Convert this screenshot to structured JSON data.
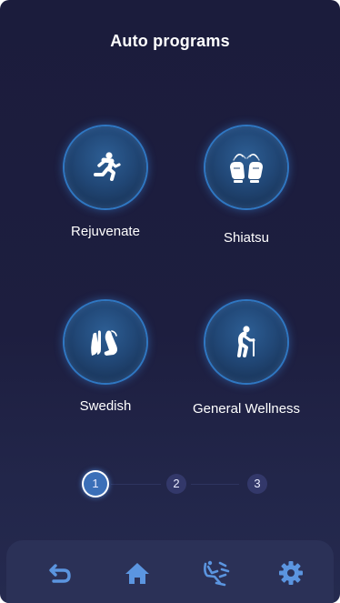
{
  "header": {
    "title": "Auto programs"
  },
  "programs": [
    {
      "label": "Rejuvenate",
      "icon": "running-person-icon"
    },
    {
      "label": "Shiatsu",
      "icon": "pressing-hands-icon"
    },
    {
      "label": "Swedish",
      "icon": "massage-hands-icon"
    },
    {
      "label": "General Wellness",
      "icon": "elderly-person-with-cane-icon"
    }
  ],
  "pagination": {
    "pages": [
      "1",
      "2",
      "3"
    ],
    "current": "1"
  },
  "bottom_nav": [
    {
      "icon": "back-icon"
    },
    {
      "icon": "home-icon"
    },
    {
      "icon": "massage-chair-icon"
    },
    {
      "icon": "settings-gear-icon"
    }
  ],
  "colors": {
    "background": "#1c1d3e",
    "button_glow": "#2f77c2",
    "active_page": "#3b6fb8",
    "bottom_bar": "#2b3157",
    "nav_icon": "#5b95e0"
  }
}
